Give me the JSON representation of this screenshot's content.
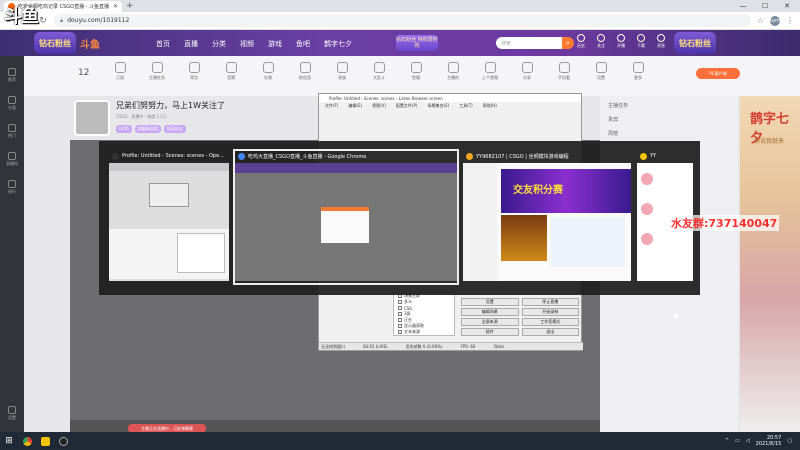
{
  "browser": {
    "tab_title": "吃鸡全服吃鸡记录 CSGO直播 - 斗鱼直播",
    "new_tab": "+",
    "url": "douyu.com/1019112",
    "avatar_initial": "tom",
    "win_minimize": "—",
    "win_maximize": "☐",
    "win_close": "✕"
  },
  "header": {
    "badge": "钻石粉丝",
    "brand": "斗鱼",
    "nav": [
      "首页",
      "直播",
      "分类",
      "视频",
      "游戏",
      "鱼吧",
      "鹊字七夕"
    ],
    "promo": "钻石粉丝 特权限时购",
    "search_placeholder": "搜索",
    "icons": [
      {
        "name": "history",
        "label": "历史"
      },
      {
        "name": "follow",
        "label": "关注"
      },
      {
        "name": "broadcast",
        "label": "开播"
      },
      {
        "name": "download",
        "label": "下载"
      },
      {
        "name": "message",
        "label": "消息"
      }
    ],
    "right_badge": "钻石粉丝"
  },
  "left_rail": [
    {
      "name": "recommend",
      "label": "推荐"
    },
    {
      "name": "channel",
      "label": "分类"
    },
    {
      "name": "hot",
      "label": "热门"
    },
    {
      "name": "live",
      "label": "直播间"
    },
    {
      "name": "rank",
      "label": "排行"
    },
    {
      "name": "settings",
      "label": "设置"
    }
  ],
  "room_bar": {
    "fans_count": "12",
    "channels": [
      "订阅",
      "主播任务",
      "背包",
      "竞猜",
      "礼物",
      "粉丝团",
      "贵族",
      "大乱斗",
      "鱼塘",
      "主播的",
      "上个视频",
      "分享",
      "手机看",
      "设置",
      "更多"
    ],
    "pc_download": "PC客户端"
  },
  "anchor": {
    "title": "兄弟们努努力，马上1W关注了",
    "meta": "CSGO · 直播中 · 热度 1.2万",
    "tags": [
      "LV46",
      "超级粉丝团",
      "钻石粉丝"
    ]
  },
  "right_panel": {
    "row1": "主播任务",
    "row2": "贵宾",
    "row3": "周榜"
  },
  "side_ad": {
    "title": "鹊字七夕",
    "subtitle": "你说我就来"
  },
  "obs": {
    "title": "Profile: Untitled - Scenes: scenes - Listen Browser screen",
    "menu": [
      "文件(F)",
      "编辑(E)",
      "视图(V)",
      "配置文件(P)",
      "场景集合(S)",
      "工具(T)",
      "帮助(H)"
    ],
    "sources": [
      "场景左屏",
      "多卡",
      "CS6",
      "3屏",
      "正在",
      "显示器获取",
      "文本来源"
    ],
    "buttons": [
      [
        "设置",
        "停止直播"
      ],
      [
        "编辑场景",
        "开始录制"
      ],
      [
        "全屏来源",
        "工作室模式"
      ],
      [
        "插件",
        "退出"
      ]
    ],
    "status": [
      "无法找到窗口",
      "00:01 (LIVE)",
      "丢失帧数 0 (0.00%)",
      "FPS: 60",
      "5kb/s"
    ]
  },
  "switcher": {
    "windows": [
      {
        "title": "Profile: Untitled - Scenes: scenes - Ope...",
        "color": "#333333"
      },
      {
        "title": "吃鸡大直播_CSGO直播_斗鱼直播 - Google Chrome",
        "color": "#4285f4"
      },
      {
        "title": "YY9682107 | CSGO | 丝绸模块游戏编程",
        "color": "#f5a623"
      },
      {
        "title": "YY",
        "color": "#f5c400"
      }
    ],
    "yy_banner": "交友积分赛"
  },
  "overlay": {
    "qq_group": "水友群:737140047"
  },
  "player": {
    "danmu_hint": "主播正在直播中，可发弹幕哦"
  },
  "taskbar": {
    "start": "⊞",
    "time": "20:57",
    "date": "2021/8/15"
  },
  "watermark": "斗鱼"
}
